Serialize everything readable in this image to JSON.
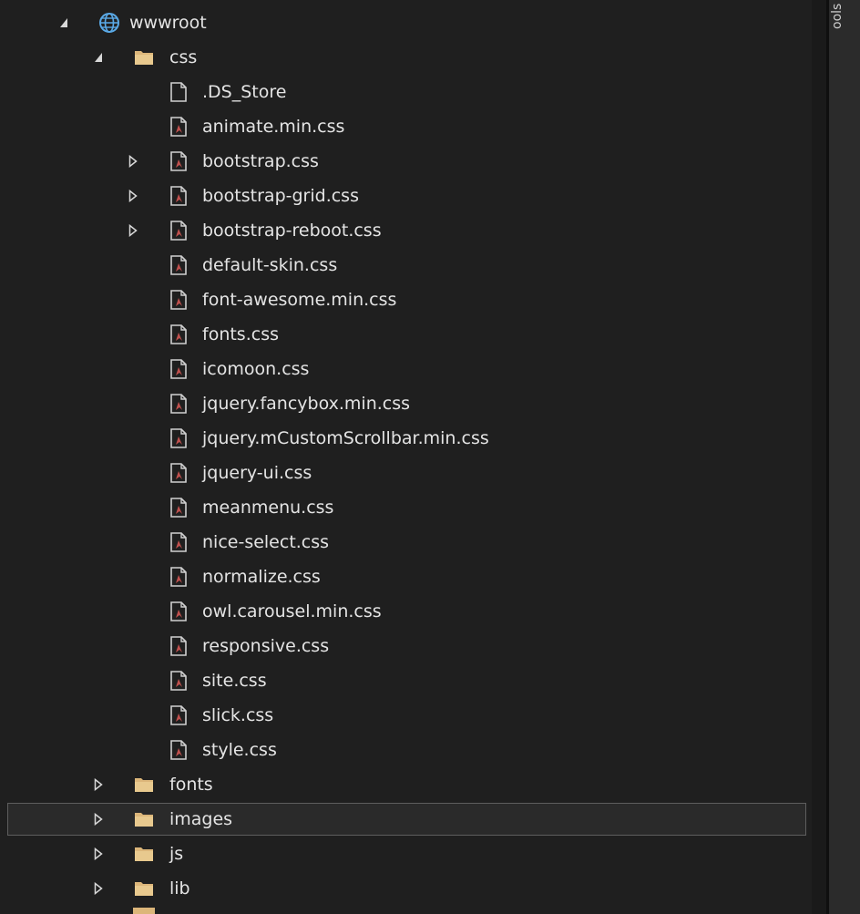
{
  "tree": {
    "items": [
      {
        "label": "wwwroot",
        "type": "globe",
        "arrow": "expanded"
      },
      {
        "label": "css",
        "type": "folder",
        "arrow": "expanded"
      },
      {
        "label": ".DS_Store",
        "type": "file",
        "arrow": "none"
      },
      {
        "label": "animate.min.css",
        "type": "css",
        "arrow": "none"
      },
      {
        "label": "bootstrap.css",
        "type": "css",
        "arrow": "collapsed"
      },
      {
        "label": "bootstrap-grid.css",
        "type": "css",
        "arrow": "collapsed"
      },
      {
        "label": "bootstrap-reboot.css",
        "type": "css",
        "arrow": "collapsed"
      },
      {
        "label": "default-skin.css",
        "type": "css",
        "arrow": "none"
      },
      {
        "label": "font-awesome.min.css",
        "type": "css",
        "arrow": "none"
      },
      {
        "label": "fonts.css",
        "type": "css",
        "arrow": "none"
      },
      {
        "label": "icomoon.css",
        "type": "css",
        "arrow": "none"
      },
      {
        "label": "jquery.fancybox.min.css",
        "type": "css",
        "arrow": "none"
      },
      {
        "label": "jquery.mCustomScrollbar.min.css",
        "type": "css",
        "arrow": "none"
      },
      {
        "label": "jquery-ui.css",
        "type": "css",
        "arrow": "none"
      },
      {
        "label": "meanmenu.css",
        "type": "css",
        "arrow": "none"
      },
      {
        "label": "nice-select.css",
        "type": "css",
        "arrow": "none"
      },
      {
        "label": "normalize.css",
        "type": "css",
        "arrow": "none"
      },
      {
        "label": "owl.carousel.min.css",
        "type": "css",
        "arrow": "none"
      },
      {
        "label": "responsive.css",
        "type": "css",
        "arrow": "none"
      },
      {
        "label": "site.css",
        "type": "css",
        "arrow": "none"
      },
      {
        "label": "slick.css",
        "type": "css",
        "arrow": "none"
      },
      {
        "label": "style.css",
        "type": "css",
        "arrow": "none"
      },
      {
        "label": "fonts",
        "type": "folder",
        "arrow": "collapsed"
      },
      {
        "label": "images",
        "type": "folder",
        "arrow": "collapsed",
        "selected": true
      },
      {
        "label": "js",
        "type": "folder",
        "arrow": "collapsed"
      },
      {
        "label": "lib",
        "type": "folder",
        "arrow": "collapsed"
      }
    ]
  },
  "right_panel": {
    "tab_label": "ools"
  },
  "colors": {
    "background": "#1f1f1f",
    "folder": "#dcb67a",
    "globe": "#5aa9e6",
    "css_file_mark": "#c0504d",
    "selection_border": "#5e5e5e"
  }
}
